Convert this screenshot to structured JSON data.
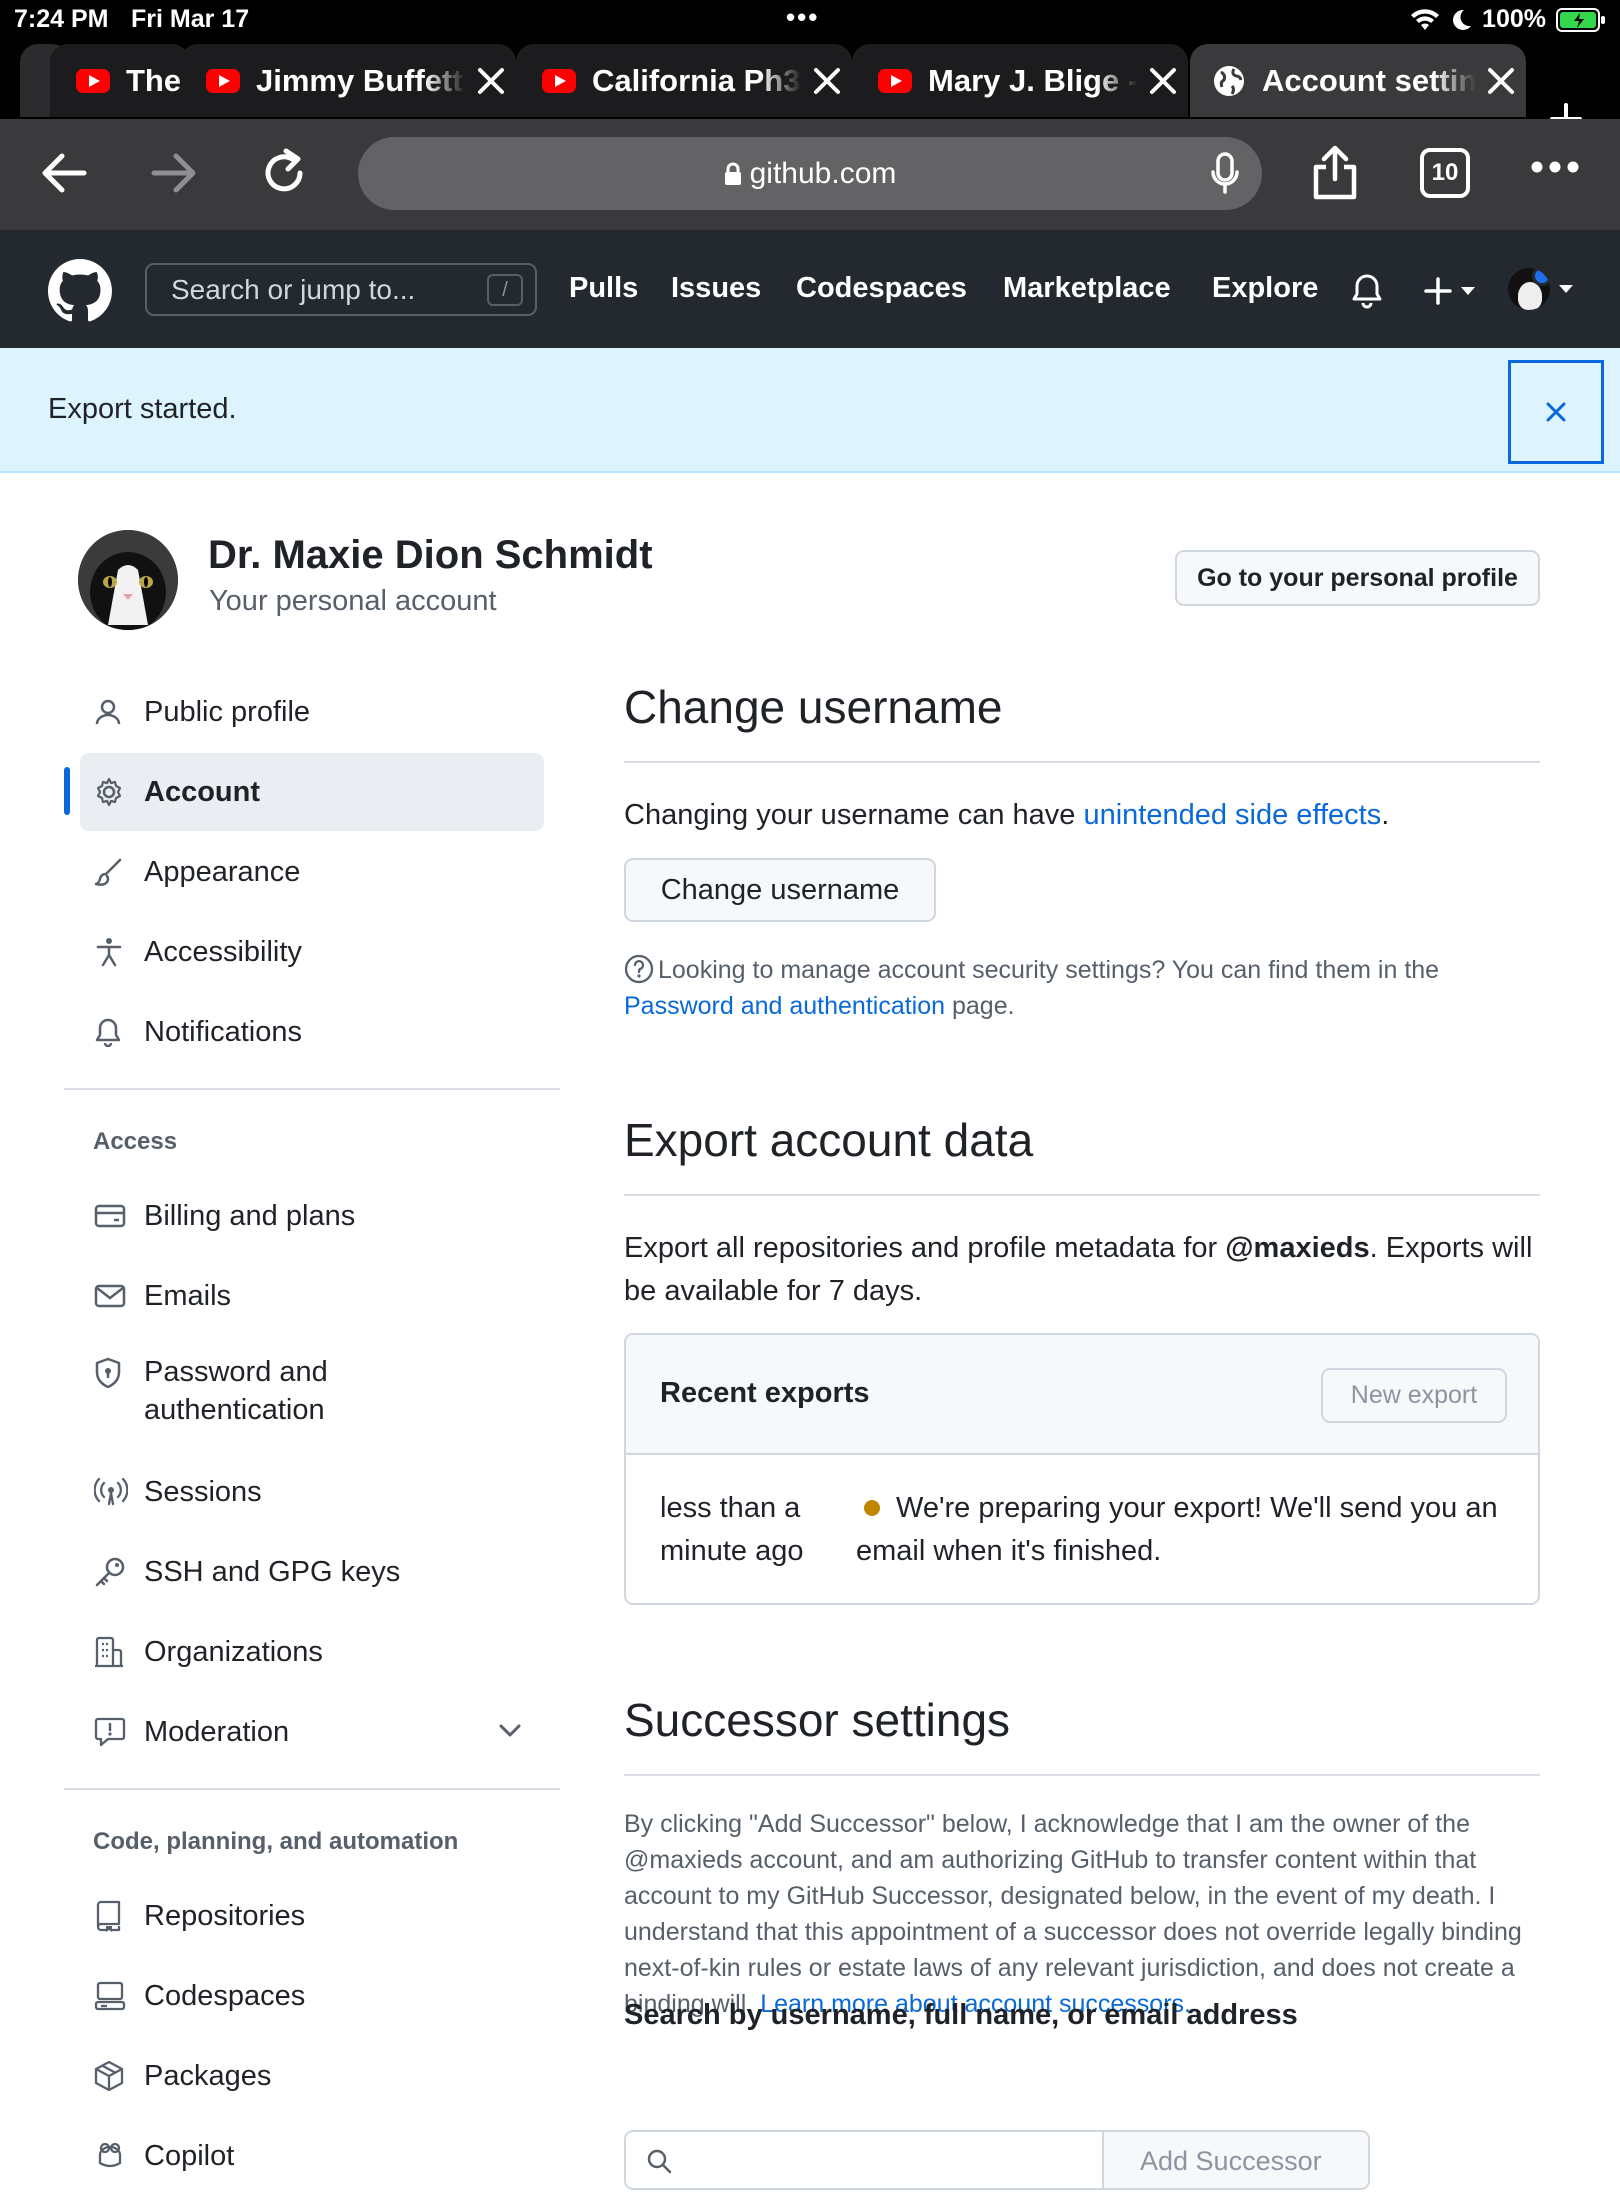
{
  "status_bar": {
    "time": "7:24 PM",
    "date": "Fri Mar 17",
    "battery": "100%"
  },
  "browser": {
    "tabs": [
      {
        "title": "The",
        "icon": "youtube-icon"
      },
      {
        "title": "Jimmy Buffett",
        "icon": "youtube-icon"
      },
      {
        "title": "California Ph3",
        "icon": "youtube-icon"
      },
      {
        "title": "Mary J. Blige -",
        "icon": "youtube-icon"
      },
      {
        "title": "Account settin",
        "icon": "globe-icon"
      }
    ],
    "url": "github.com",
    "tab_count": "10"
  },
  "github_header": {
    "search_placeholder": "Search or jump to...",
    "search_shortcut": "/",
    "nav": [
      "Pulls",
      "Issues",
      "Codespaces",
      "Marketplace",
      "Explore"
    ]
  },
  "flash": {
    "message": "Export started."
  },
  "user": {
    "name": "Dr. Maxie Dion Schmidt",
    "subtitle": "Your personal account",
    "profile_button": "Go to your personal profile"
  },
  "sidebar": {
    "items": [
      {
        "label": "Public profile",
        "icon": "person-icon"
      },
      {
        "label": "Account",
        "icon": "gear-icon",
        "active": true
      },
      {
        "label": "Appearance",
        "icon": "paintbrush-icon"
      },
      {
        "label": "Accessibility",
        "icon": "accessibility-icon"
      },
      {
        "label": "Notifications",
        "icon": "bell-icon"
      }
    ],
    "access_heading": "Access",
    "access_items": [
      {
        "label": "Billing and plans",
        "icon": "credit-card-icon"
      },
      {
        "label": "Emails",
        "icon": "mail-icon"
      },
      {
        "label": "Password and",
        "label2": "authentication",
        "icon": "shield-icon"
      },
      {
        "label": "Sessions",
        "icon": "broadcast-icon"
      },
      {
        "label": "SSH and GPG keys",
        "icon": "key-icon"
      },
      {
        "label": "Organizations",
        "icon": "organization-icon"
      },
      {
        "label": "Moderation",
        "icon": "report-icon"
      }
    ],
    "code_heading": "Code, planning, and automation",
    "code_items": [
      {
        "label": "Repositories",
        "icon": "repo-icon"
      },
      {
        "label": "Codespaces",
        "icon": "codespaces-icon"
      },
      {
        "label": "Packages",
        "icon": "package-icon"
      },
      {
        "label": "Copilot",
        "icon": "copilot-icon"
      }
    ]
  },
  "change_username": {
    "title": "Change username",
    "text_before": "Changing your username can have ",
    "link": "unintended side effects",
    "text_after": ".",
    "button": "Change username",
    "note_before": "Looking to manage account security settings? You can find them in the ",
    "note_link": "Password and authentication",
    "note_after": " page."
  },
  "export": {
    "title": "Export account data",
    "text_before": "Export all repositories and profile metadata for ",
    "handle": "@maxieds",
    "text_after": ". Exports will be available for 7 days.",
    "box_title": "Recent exports",
    "new_export": "New export",
    "when": "less than a minute ago",
    "status_text": "We're preparing your export! We'll send you an email when it's finished."
  },
  "successor": {
    "title": "Successor settings",
    "legal": "By clicking \"Add Successor\" below, I acknowledge that I am the owner of the @maxieds account, and am authorizing GitHub to transfer content within that account to my GitHub Successor, designated below, in the event of my death. I understand that this appointment of a successor does not override legally binding next-of-kin rules or estate laws of any relevant jurisdiction, and does not create a binding will. ",
    "legal_link": "Learn more about account successors.",
    "search_label": "Search by username, full name, or email address",
    "add_button": "Add Successor"
  }
}
